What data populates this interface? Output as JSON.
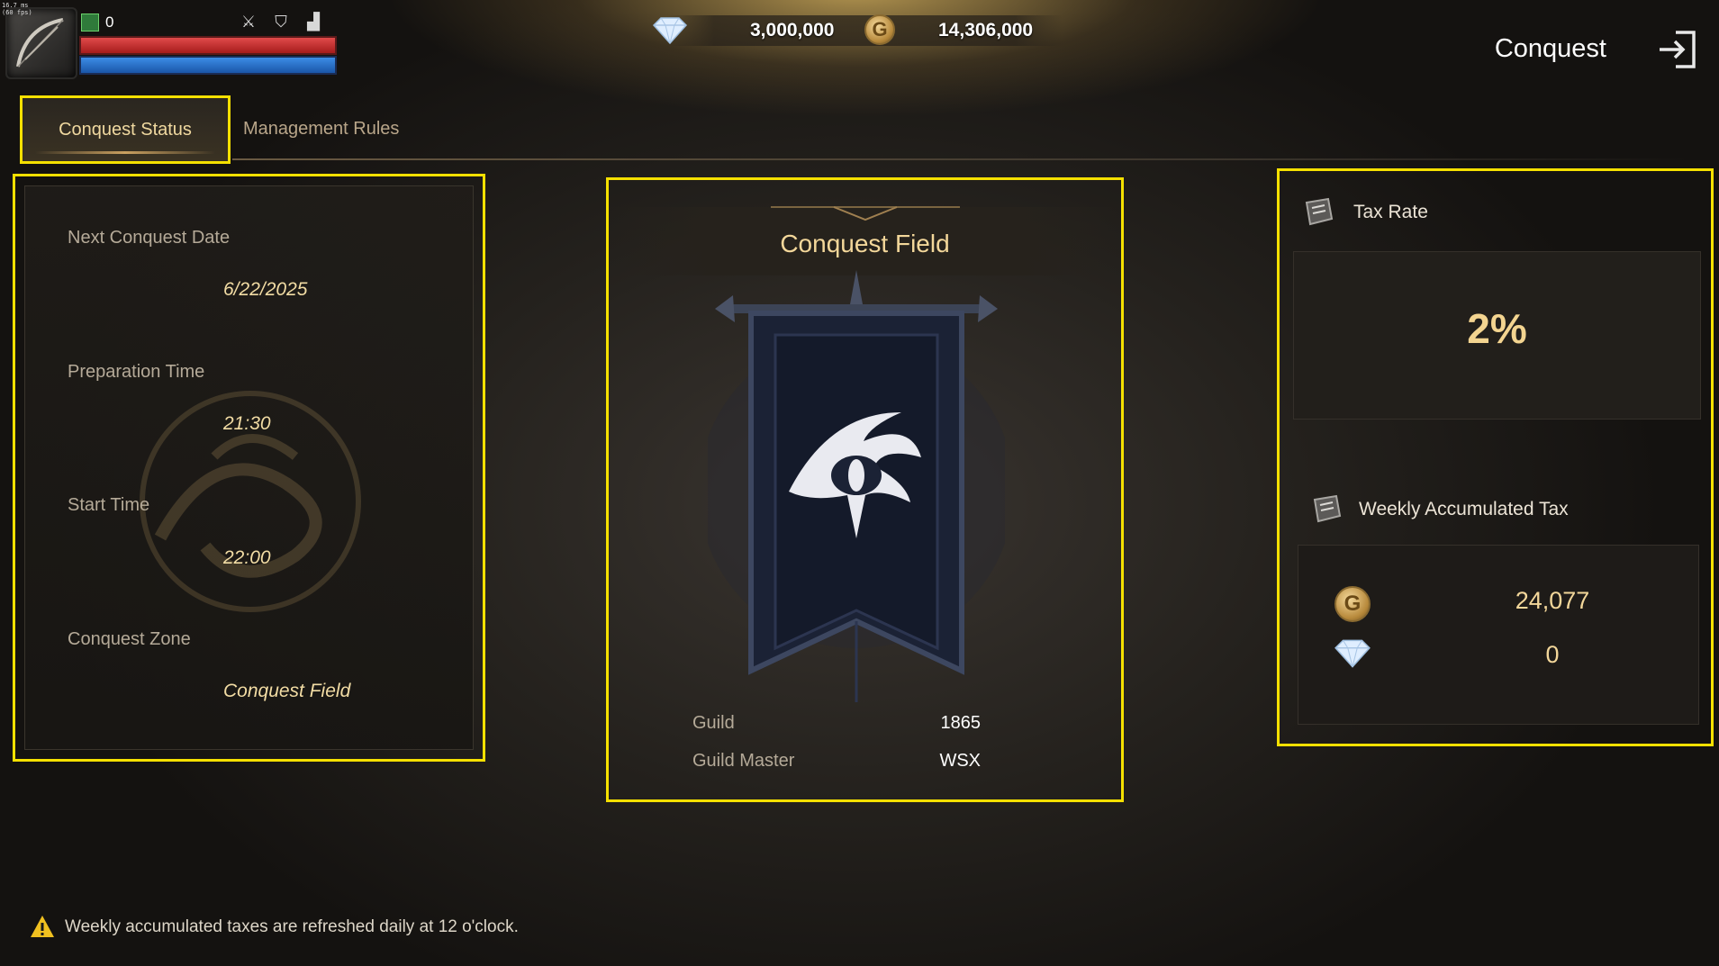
{
  "hud": {
    "fps_line1": "16.7 ms",
    "fps_line2": "(60 fps)",
    "stat_value": "0",
    "status_icons": [
      "crossed-swords-icon",
      "shield-icon",
      "boot-icon"
    ],
    "colors": {
      "hp": "#c42a2a",
      "mp": "#2a6ec4"
    }
  },
  "currency": {
    "diamonds": "3,000,000",
    "gold": "14,306,000",
    "gold_symbol": "G"
  },
  "header": {
    "title": "Conquest",
    "exit_icon": "exit-icon"
  },
  "tabs": [
    {
      "label": "Conquest Status",
      "active": true
    },
    {
      "label": "Management Rules",
      "active": false
    }
  ],
  "schedule": {
    "next_date_label": "Next Conquest Date",
    "next_date_value": "6/22/2025",
    "prep_label": "Preparation Time",
    "prep_value": "21:30",
    "start_label": "Start Time",
    "start_value": "22:00",
    "zone_label": "Conquest Zone",
    "zone_value": "Conquest Field"
  },
  "field": {
    "title": "Conquest Field",
    "guild_label": "Guild",
    "guild_value": "1865",
    "master_label": "Guild Master",
    "master_value": "WSX"
  },
  "tax": {
    "rate_label": "Tax Rate",
    "rate_value": "2%",
    "weekly_label": "Weekly Accumulated Tax",
    "weekly_gold": "24,077",
    "weekly_diamonds": "0"
  },
  "notice": {
    "text": "Weekly accumulated taxes are refreshed daily at 12 o'clock.",
    "accent": "#f0c020"
  },
  "colors": {
    "highlight_border": "#f5e000",
    "gold_text": "#f3d79a"
  }
}
